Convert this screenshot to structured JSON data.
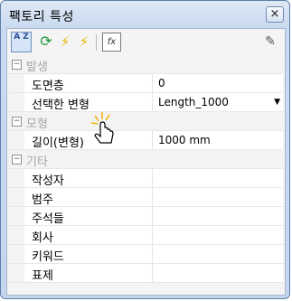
{
  "window": {
    "title": "팩토리 특성",
    "close": "×"
  },
  "toolbar": {
    "sort_label": "A Z",
    "fx_label": "fx"
  },
  "categories": [
    {
      "label": "발생",
      "props": [
        {
          "name": "도면층",
          "value": "0"
        },
        {
          "name": "선택한 변형",
          "value": "Length_1000",
          "dropdown": true
        }
      ]
    },
    {
      "label": "모형",
      "props": [
        {
          "name": "길이(변형)",
          "value": "1000 mm"
        }
      ]
    },
    {
      "label": "기타",
      "props": [
        {
          "name": "작성자",
          "value": ""
        },
        {
          "name": "범주",
          "value": ""
        },
        {
          "name": "주석들",
          "value": ""
        },
        {
          "name": "회사",
          "value": ""
        },
        {
          "name": "키워드",
          "value": ""
        },
        {
          "name": "표제",
          "value": ""
        }
      ]
    }
  ],
  "colors": {
    "category_text": "#a8a8a8",
    "window_border": "#5b7fa8"
  }
}
